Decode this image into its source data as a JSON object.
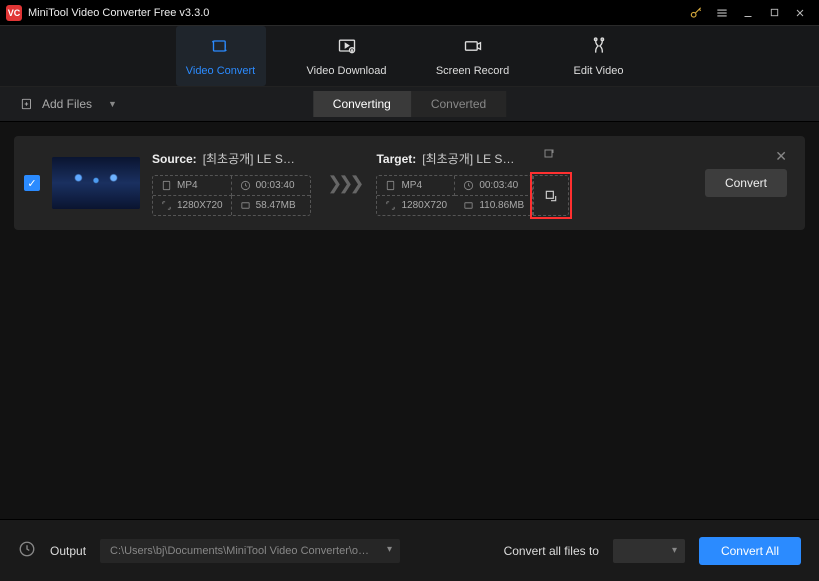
{
  "titlebar": {
    "title": "MiniTool Video Converter Free v3.3.0"
  },
  "nav": {
    "video_convert": "Video Convert",
    "video_download": "Video Download",
    "screen_record": "Screen Record",
    "edit_video": "Edit Video"
  },
  "subbar": {
    "add_files": "Add Files",
    "tab_converting": "Converting",
    "tab_converted": "Converted"
  },
  "item": {
    "source_label": "Source:",
    "source_file": "[최초공개] LE SSERA...",
    "source_format": "MP4",
    "source_duration": "00:03:40",
    "source_res": "1280X720",
    "source_size": "58.47MB",
    "target_label": "Target:",
    "target_file": "[최초공개] LE SSERA...",
    "target_format": "MP4",
    "target_duration": "00:03:40",
    "target_res": "1280X720",
    "target_size": "110.86MB",
    "convert": "Convert"
  },
  "footer": {
    "output_label": "Output",
    "output_path": "C:\\Users\\bj\\Documents\\MiniTool Video Converter\\output",
    "convert_all_to": "Convert all files to",
    "convert_all": "Convert All"
  }
}
